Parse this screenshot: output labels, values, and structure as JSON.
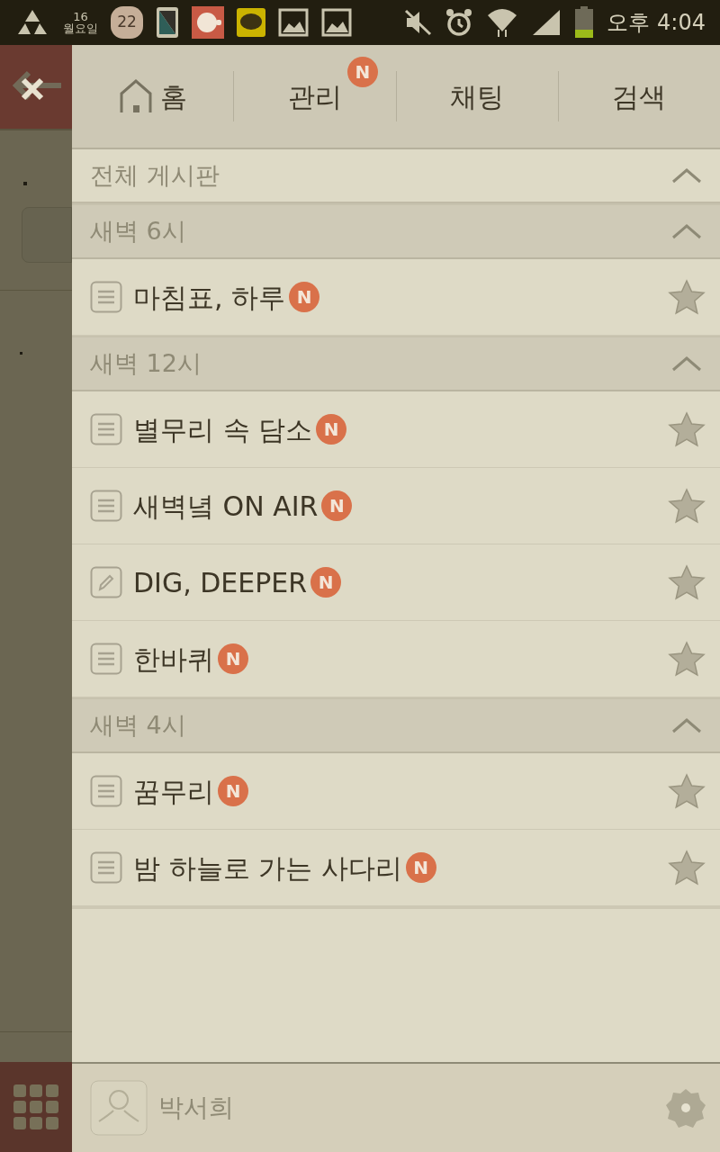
{
  "status_bar": {
    "date_day": "16",
    "date_weekday": "월요일",
    "flower_count": "22",
    "time": "오후 4:04"
  },
  "nav_tabs": [
    {
      "label": "홈"
    },
    {
      "label": "관리",
      "badge": "N"
    },
    {
      "label": "채팅"
    },
    {
      "label": "검색"
    }
  ],
  "all_boards": {
    "label": "전체 게시판",
    "expanded": true
  },
  "groups": [
    {
      "name": "새벽 6시",
      "expanded": true,
      "boards": [
        {
          "title": "마침표, 하루",
          "kind": "list",
          "badge": "N",
          "starred": false
        }
      ]
    },
    {
      "name": "새벽 12시",
      "expanded": true,
      "boards": [
        {
          "title": "별무리 속 담소",
          "kind": "list",
          "badge": "N",
          "starred": false
        },
        {
          "title": "새벽녘 ON AIR",
          "kind": "list",
          "badge": "N",
          "starred": false
        },
        {
          "title": "DIG, DEEPER",
          "kind": "edit",
          "badge": "N",
          "starred": false
        },
        {
          "title": "한바퀴",
          "kind": "list",
          "badge": "N",
          "starred": false
        }
      ]
    },
    {
      "name": "새벽 4시",
      "expanded": true,
      "boards": [
        {
          "title": "꿈무리",
          "kind": "list",
          "badge": "N",
          "starred": false
        },
        {
          "title": "밤 하늘로 가는 사다리",
          "kind": "list",
          "badge": "N",
          "starred": false
        }
      ]
    }
  ],
  "footer": {
    "user_name": "박서희"
  }
}
